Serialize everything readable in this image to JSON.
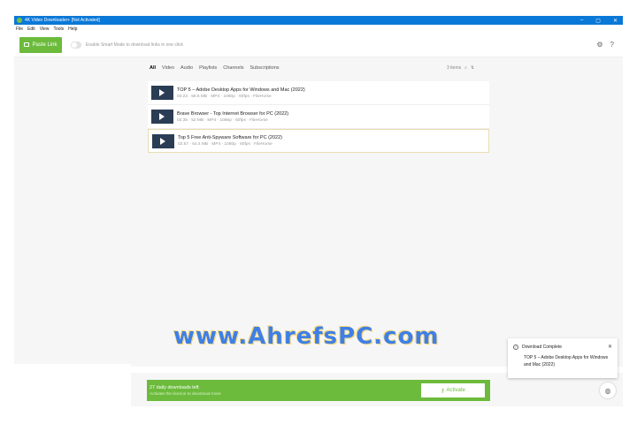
{
  "window": {
    "title": "4K Video Downloader+ [Not Activated]",
    "controls": [
      "–",
      "▢",
      "✕"
    ]
  },
  "menu": [
    "File",
    "Edit",
    "View",
    "Tools",
    "Help"
  ],
  "toolbar": {
    "paste_link": "Paste Link",
    "smart_mode_text": "Enable Smart Mode to download links in one click",
    "icons": [
      "gear-icon",
      "help-icon"
    ]
  },
  "tabs": [
    {
      "label": "All",
      "active": true
    },
    {
      "label": "Video"
    },
    {
      "label": "Audio"
    },
    {
      "label": "Playlists"
    },
    {
      "label": "Channels"
    },
    {
      "label": "Subscriptions"
    }
  ],
  "items_info": {
    "count": "3 items"
  },
  "downloads": [
    {
      "title": "TOP 5 – Adobe Desktop Apps for Windows and Mac (2022)",
      "meta": "03:23 · 58.6 MB · MP4 · 1080p · 60fps · FileHorse"
    },
    {
      "title": "Brave Browser - Top Internet Browser for PC (2022)",
      "meta": "02:35 · 52 MB · MP4 · 1080p · 60fps · FileHorse"
    },
    {
      "title": "Top 5 Free Anti-Spyware Software for PC (2022)",
      "meta": "02:57 · 64.4 MB · MP4 · 1080p · 60fps · FileHorse"
    }
  ],
  "watermark": "www.AhrefsPC.com",
  "promo": {
    "line1": "27 daily downloads left",
    "line2": "Activate the licence to download more",
    "button": "Activate"
  },
  "toast": {
    "title": "Download Complete",
    "body": "TOP 5 – Adobe Desktop Apps for Windows and Mac (2022)"
  },
  "colors": {
    "accent": "#6cbb3c",
    "titlebar": "#0a78d7"
  }
}
